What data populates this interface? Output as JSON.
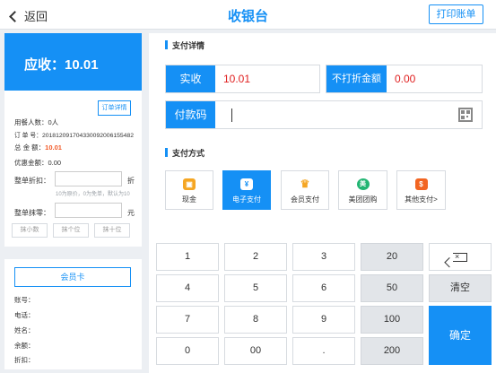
{
  "header": {
    "back_label": "返回",
    "title": "收银台",
    "print_label": "打印账单"
  },
  "summary": {
    "due_label": "应收：10.01",
    "order_detail_btn": "订单详情",
    "diners": "用餐人数：0人",
    "order_no": "订 单 号：20181209170433009200615548​2",
    "total_label": "总 金 额：",
    "total_value": "10.01",
    "discount_amount": "优惠金额：0.00",
    "whole_discount_label": "整单折扣：",
    "whole_discount_suffix": "折",
    "discount_hint": "10为原价，0为免单，默认为10",
    "round_label": "整单抹零：",
    "round_suffix": "元",
    "round_buttons": [
      "抹小数",
      "抹个位",
      "抹十位"
    ]
  },
  "member": {
    "card_btn": "会员卡",
    "fields": [
      "账号：",
      "电话：",
      "姓名：",
      "余额：",
      "折扣："
    ]
  },
  "payment_detail": {
    "section_title": "支付详情",
    "received_label": "实收",
    "received_value": "10.01",
    "nodiscount_label": "不打折金额",
    "nodiscount_value": "0.00",
    "paycode_label": "付款码"
  },
  "payment_method": {
    "section_title": "支付方式",
    "methods": [
      {
        "label": "现金",
        "icon": "cash-icon",
        "color": "#f5a623",
        "glyph": "▣"
      },
      {
        "label": "电子支付",
        "icon": "yen-icon",
        "color": "#1590f5",
        "glyph": "¥"
      },
      {
        "label": "会员支付",
        "icon": "crown-icon",
        "color": "#f5a623",
        "glyph": "♛"
      },
      {
        "label": "美团团购",
        "icon": "meituan-icon",
        "color": "#22b573",
        "glyph": "美"
      },
      {
        "label": "其他支付>",
        "icon": "other-pay-icon",
        "color": "#f26522",
        "glyph": "$"
      }
    ]
  },
  "keypad": {
    "digits": [
      "1",
      "2",
      "3",
      "4",
      "5",
      "6",
      "7",
      "8",
      "9",
      "0",
      "00",
      "."
    ],
    "quick": [
      "20",
      "50",
      "100",
      "200"
    ],
    "clear": "清空",
    "confirm": "确定"
  },
  "colors": {
    "accent": "#1590f5",
    "red": "#e02020",
    "orange": "#f25a28"
  }
}
